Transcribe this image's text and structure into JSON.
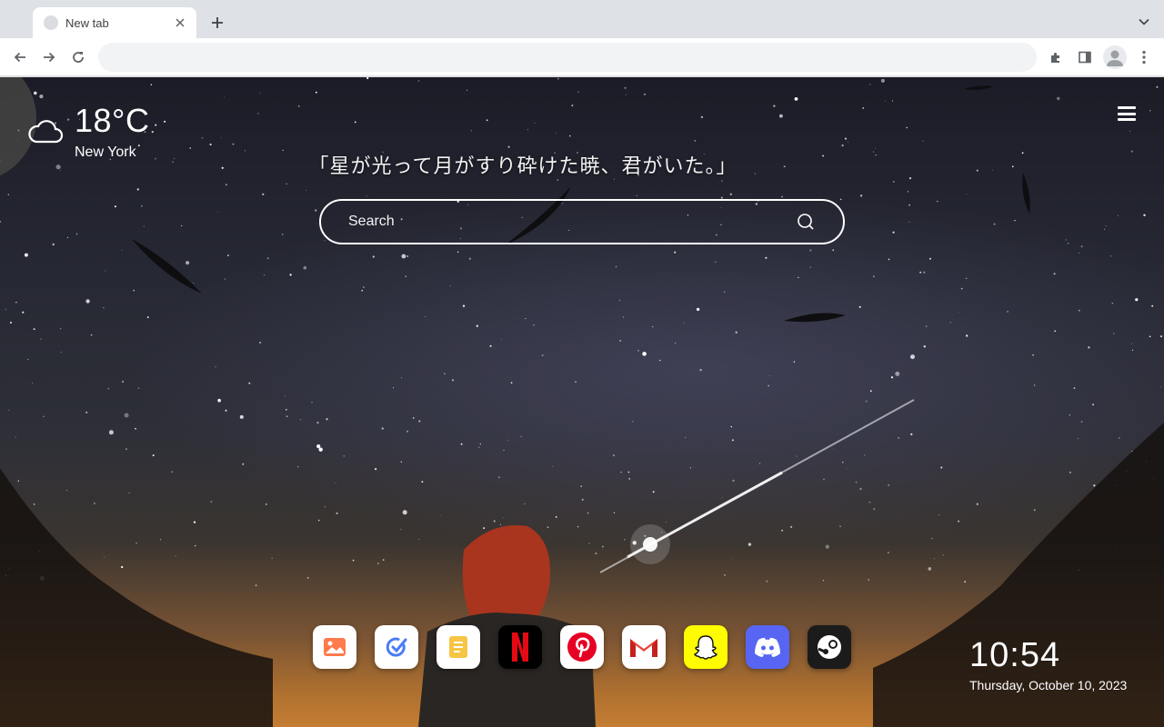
{
  "browser": {
    "tab": {
      "title": "New tab"
    },
    "omnibox": {
      "value": ""
    }
  },
  "weather": {
    "temperature": "18°C",
    "city": "New York",
    "icon": "cloud-icon"
  },
  "quote": "「星が光って月がすり砕けた暁、君がいた。」",
  "search": {
    "placeholder": "Search"
  },
  "dock": {
    "apps": [
      {
        "name": "Photos",
        "icon": "photos-icon"
      },
      {
        "name": "Tasks",
        "icon": "tasks-icon"
      },
      {
        "name": "Notes",
        "icon": "notes-icon"
      },
      {
        "name": "Netflix",
        "icon": "netflix-icon"
      },
      {
        "name": "Pinterest",
        "icon": "pinterest-icon"
      },
      {
        "name": "Gmail",
        "icon": "gmail-icon"
      },
      {
        "name": "Snapchat",
        "icon": "snapchat-icon"
      },
      {
        "name": "Discord",
        "icon": "discord-icon"
      },
      {
        "name": "Steam",
        "icon": "steam-icon"
      }
    ]
  },
  "clock": {
    "time": "10:54",
    "date": "Thursday, October 10, 2023"
  },
  "colors": {
    "chrome_bg": "#dee1e6",
    "netflix_red": "#e50914",
    "pinterest_red": "#e60023",
    "snapchat_yellow": "#fffc00",
    "discord_blurple": "#5865f2",
    "steam_dark": "#1b1b1b"
  }
}
